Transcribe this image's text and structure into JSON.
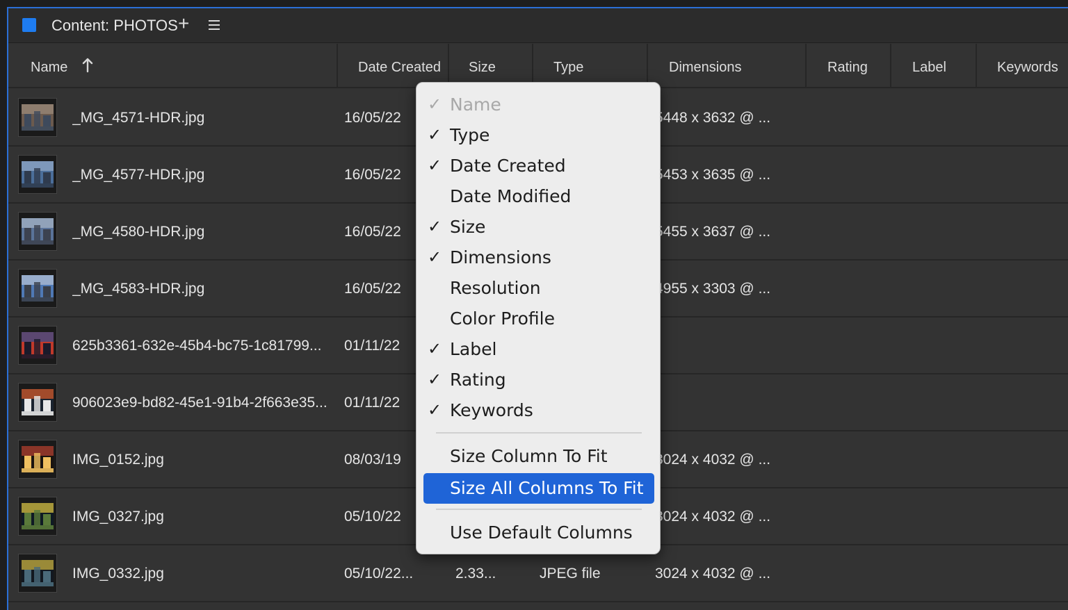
{
  "panel": {
    "title": "Content: PHOTOS",
    "add_icon": "plus-icon",
    "menu_icon": "hamburger-icon",
    "accent": "#1e7cf0"
  },
  "columns": {
    "name": "Name",
    "date_created": "Date Created",
    "size": "Size",
    "type": "Type",
    "dimensions": "Dimensions",
    "rating": "Rating",
    "label": "Label",
    "keywords": "Keywords",
    "sort": "ascending"
  },
  "rows": [
    {
      "name": "_MG_4571-HDR.jpg",
      "date": "16/05/22",
      "size": "",
      "type": "",
      "dimensions": "5448 x 3632 @ ...",
      "thumb": [
        "#6b5a4e",
        "#9a8a7a",
        "#3e4a5c"
      ]
    },
    {
      "name": "_MG_4577-HDR.jpg",
      "date": "16/05/22",
      "size": "",
      "type": "",
      "dimensions": "5453 x 3635 @ ...",
      "thumb": [
        "#4b6e9a",
        "#8fa7c4",
        "#2f3b4e"
      ]
    },
    {
      "name": "_MG_4580-HDR.jpg",
      "date": "16/05/22",
      "size": "",
      "type": "",
      "dimensions": "5455 x 3637 @ ...",
      "thumb": [
        "#5a7399",
        "#a4b2c4",
        "#3c4250"
      ]
    },
    {
      "name": "_MG_4583-HDR.jpg",
      "date": "16/05/22",
      "size": "",
      "type": "",
      "dimensions": "4955 x 3303 @ ...",
      "thumb": [
        "#4f79b5",
        "#b0bfd4",
        "#393f4a"
      ]
    },
    {
      "name": "625b3361-632e-45b4-bc75-1c81799...",
      "date": "01/11/22",
      "size": "",
      "type": "",
      "dimensions": "",
      "thumb": [
        "#c0392b",
        "#3a4c8a",
        "#1a1a2a"
      ]
    },
    {
      "name": "906023e9-bd82-45e1-91b4-2f663e35...",
      "date": "01/11/22",
      "size": "",
      "type": "",
      "dimensions": "",
      "thumb": [
        "#1b2430",
        "#d0582a",
        "#e8e8e8"
      ]
    },
    {
      "name": "IMG_0152.jpg",
      "date": "08/03/19",
      "size": "",
      "type": "",
      "dimensions": "3024 x 4032 @ ...",
      "thumb": [
        "#1a1410",
        "#b04030",
        "#f0c060"
      ]
    },
    {
      "name": "IMG_0327.jpg",
      "date": "05/10/22",
      "size": "",
      "type": "",
      "dimensions": "3024 x 4032 @ ...",
      "thumb": [
        "#0f1a24",
        "#d8c040",
        "#5a7a3a"
      ]
    },
    {
      "name": "IMG_0332.jpg",
      "date": "05/10/22...",
      "size": "2.33...",
      "type": "JPEG file",
      "dimensions": "3024 x 4032 @ ...",
      "thumb": [
        "#121820",
        "#c8b040",
        "#4a6a7a"
      ]
    }
  ],
  "context_menu": {
    "items": [
      {
        "label": "Name",
        "checked": true,
        "disabled": true
      },
      {
        "label": "Type",
        "checked": true
      },
      {
        "label": "Date Created",
        "checked": true
      },
      {
        "label": "Date Modified",
        "checked": false
      },
      {
        "label": "Size",
        "checked": true
      },
      {
        "label": "Dimensions",
        "checked": true
      },
      {
        "label": "Resolution",
        "checked": false
      },
      {
        "label": "Color Profile",
        "checked": false
      },
      {
        "label": "Label",
        "checked": true
      },
      {
        "label": "Rating",
        "checked": true
      },
      {
        "label": "Keywords",
        "checked": true
      }
    ],
    "size_column_to_fit": "Size Column To Fit",
    "size_all_columns_to_fit": "Size All Columns To Fit",
    "use_default_columns": "Use Default Columns",
    "check_glyph": "✓",
    "highlight": "#1f64d7"
  }
}
